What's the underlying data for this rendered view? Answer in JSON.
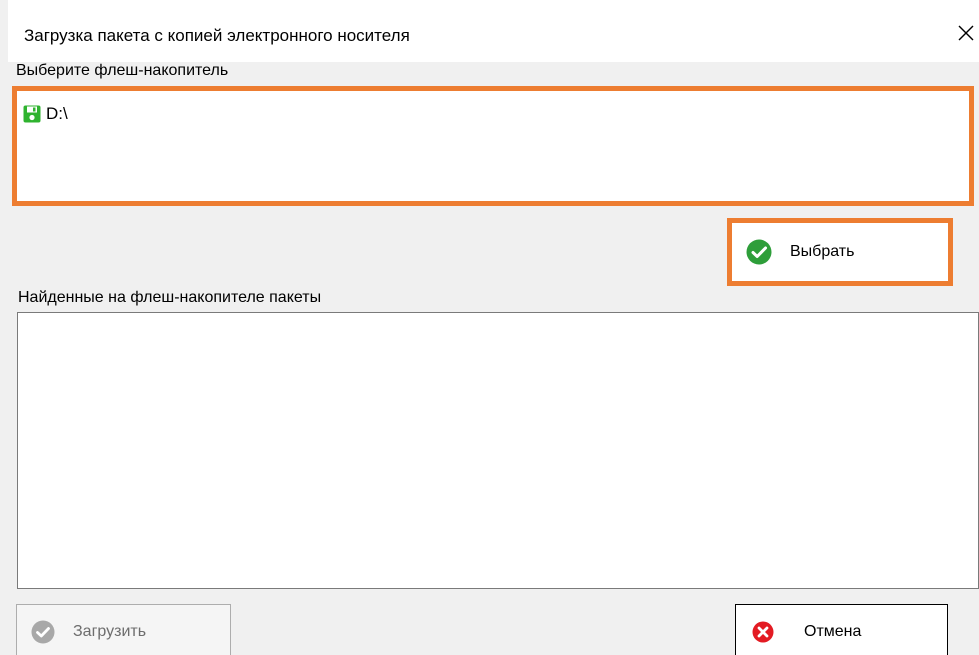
{
  "window": {
    "title": "Загрузка пакета с копией электронного носителя",
    "close_icon": "close-icon"
  },
  "drives_section": {
    "label": "Выберите флеш-накопитель",
    "items": [
      {
        "label": "D:\\",
        "icon": "floppy-disk-icon",
        "icon_color": "#2fb32f"
      }
    ],
    "highlight_color": "#ed7d31"
  },
  "select_button": {
    "label": "Выбрать",
    "icon": "check-circle-icon",
    "icon_color": "#2e9e3a"
  },
  "packages_section": {
    "label": "Найденные на флеш-накопителе пакеты",
    "items": []
  },
  "load_button": {
    "label": "Загрузить",
    "icon": "check-circle-icon",
    "icon_color": "#a8a8a8",
    "enabled": false
  },
  "cancel_button": {
    "label": "Отмена",
    "icon": "x-circle-icon",
    "icon_color": "#e31b23"
  }
}
